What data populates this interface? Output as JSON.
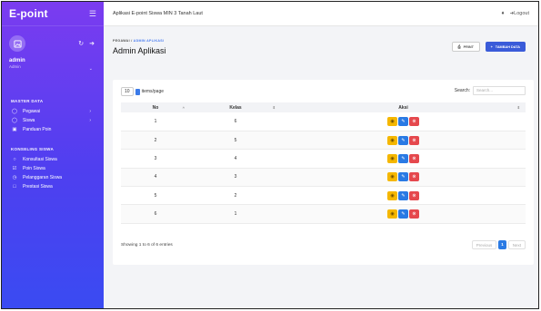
{
  "sidebar": {
    "brand": "E-point",
    "user": {
      "name": "admin",
      "role": "Admin"
    },
    "sections": [
      {
        "title": "MASTER DATA",
        "items": [
          {
            "label": "Pegawai",
            "icon": "person-icon",
            "chevron": true
          },
          {
            "label": "Siswa",
            "icon": "people-icon",
            "chevron": true
          },
          {
            "label": "Panduan Poin",
            "icon": "document-icon",
            "chevron": false
          }
        ]
      },
      {
        "title": "KONSELING SISWA",
        "items": [
          {
            "label": "Konsultasi Siswa",
            "icon": "chat-icon",
            "chevron": false
          },
          {
            "label": "Poin Siswa",
            "icon": "check-square-icon",
            "chevron": false
          },
          {
            "label": "Pelanggaran Siswa",
            "icon": "clock-icon",
            "chevron": false
          },
          {
            "label": "Prestasi Siswa",
            "icon": "award-icon",
            "chevron": false
          }
        ]
      }
    ]
  },
  "topbar": {
    "title": "Aplikasi E-point Siswa MIN 3 Tanah Laut",
    "logout": "Logout"
  },
  "header": {
    "breadcrumb_parent": "PEGAWAI",
    "breadcrumb_sep": "/",
    "breadcrumb_current": "ADMIN APLIKASI",
    "title": "Admin Aplikasi",
    "print_label": "PRINT",
    "add_label": "TAMBAH DATA"
  },
  "table": {
    "per_page_value": "10",
    "per_page_label": "items/page",
    "search_label": "Search:",
    "search_placeholder": "Search...",
    "columns": [
      "No",
      "Kelas",
      "Aksi"
    ],
    "rows": [
      {
        "no": "1",
        "kelas": "6"
      },
      {
        "no": "2",
        "kelas": "5"
      },
      {
        "no": "3",
        "kelas": "4"
      },
      {
        "no": "4",
        "kelas": "3"
      },
      {
        "no": "5",
        "kelas": "2"
      },
      {
        "no": "6",
        "kelas": "1"
      }
    ],
    "info": "Showing 1 to 6 of 6 entries",
    "pagination": {
      "previous": "Previous",
      "current": "1",
      "next": "Next"
    }
  },
  "colors": {
    "sidebar_top": "#7b3cf0",
    "sidebar_bottom": "#3a4bf2",
    "primary": "#3a5bd9",
    "view": "#f5b700",
    "edit": "#2a7ae4",
    "delete": "#e5484d"
  }
}
